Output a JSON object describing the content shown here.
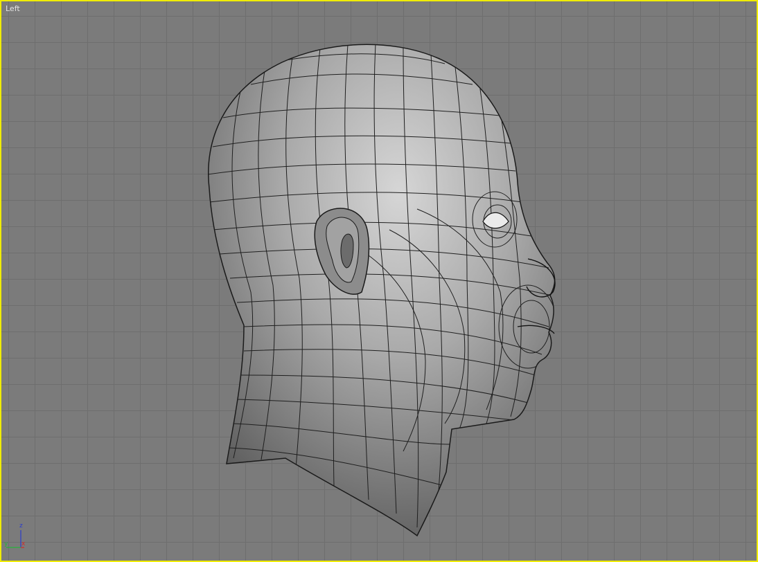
{
  "viewport": {
    "label": "Left",
    "border_color": "#f0ec00",
    "background_color": "#7b7b7b",
    "grid_color": "#6e6e6e",
    "model": "head-mesh",
    "wireframe_overlay": true
  },
  "axis_gizmo": {
    "z_label": "z",
    "y_label": "y",
    "x_label": "x",
    "z_color": "#2b3ccc",
    "y_color": "#27b23a",
    "x_color": "#d42a2a"
  }
}
